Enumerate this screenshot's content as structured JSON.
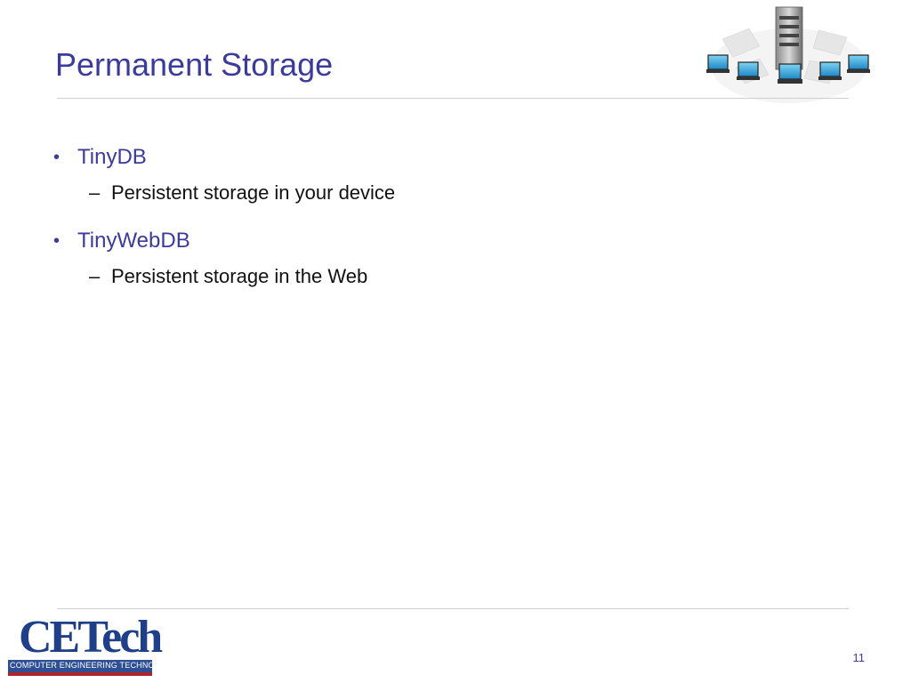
{
  "slide": {
    "title": "Permanent Storage",
    "page_number": "11"
  },
  "bullets": [
    {
      "label": "TinyDB",
      "sub": "Persistent storage in your device"
    },
    {
      "label": "TinyWebDB",
      "sub": "Persistent storage in the Web"
    }
  ],
  "bullet_symbol": "•",
  "sub_symbol": "–",
  "logo": {
    "main_text": "CETech",
    "sub_text": "COMPUTER ENGINEERING TECHNOLOGY"
  },
  "graphic": {
    "icon": "network-server-icon"
  },
  "colors": {
    "title": "#3b3b9b",
    "body": "#111111",
    "logo_blue": "#1f3f88",
    "logo_red": "#b0242a"
  }
}
